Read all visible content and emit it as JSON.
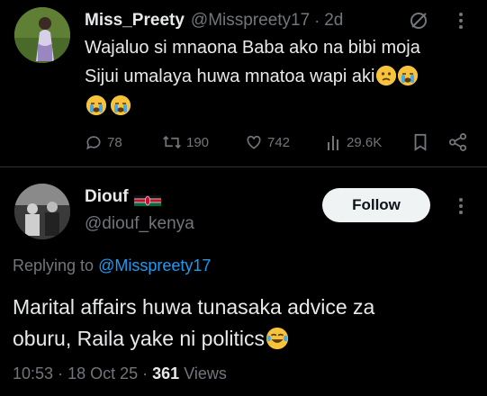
{
  "tweet": {
    "author_name": "Miss_Preety",
    "author_handle": "@Misspreety17",
    "time": "2d",
    "text_line1": "Wajaluo si mnaona Baba ako na bibi moja",
    "text_line2": "Sijui umalaya huwa mnatoa wapi aki",
    "emojis_line2": [
      "worried-face-emoji",
      "crying-face-emoji"
    ],
    "emojis_line3": [
      "crying-face-emoji",
      "crying-face-emoji"
    ],
    "stats": {
      "replies": "78",
      "reposts": "190",
      "likes": "742",
      "views": "29.6K"
    }
  },
  "reply": {
    "author_name": "Diouf",
    "author_handle": "@diouf_kenya",
    "badge": "kenya-flag",
    "follow_label": "Follow",
    "replying_prefix": "Replying to",
    "replying_to": "@Misspreety17",
    "text_line1": "Marital affairs huwa tunasaka advice za",
    "text_line2": "oburu, Raila yake ni politics",
    "time": "10:53",
    "date": "18 Oct 25",
    "views_count": "361",
    "views_label": "Views"
  },
  "colors": {
    "background": "#000000",
    "text": "#e7e9ea",
    "muted": "#71767b",
    "link": "#1d9bf0",
    "divider": "#2f3336",
    "follow_bg": "#eff3f4"
  }
}
